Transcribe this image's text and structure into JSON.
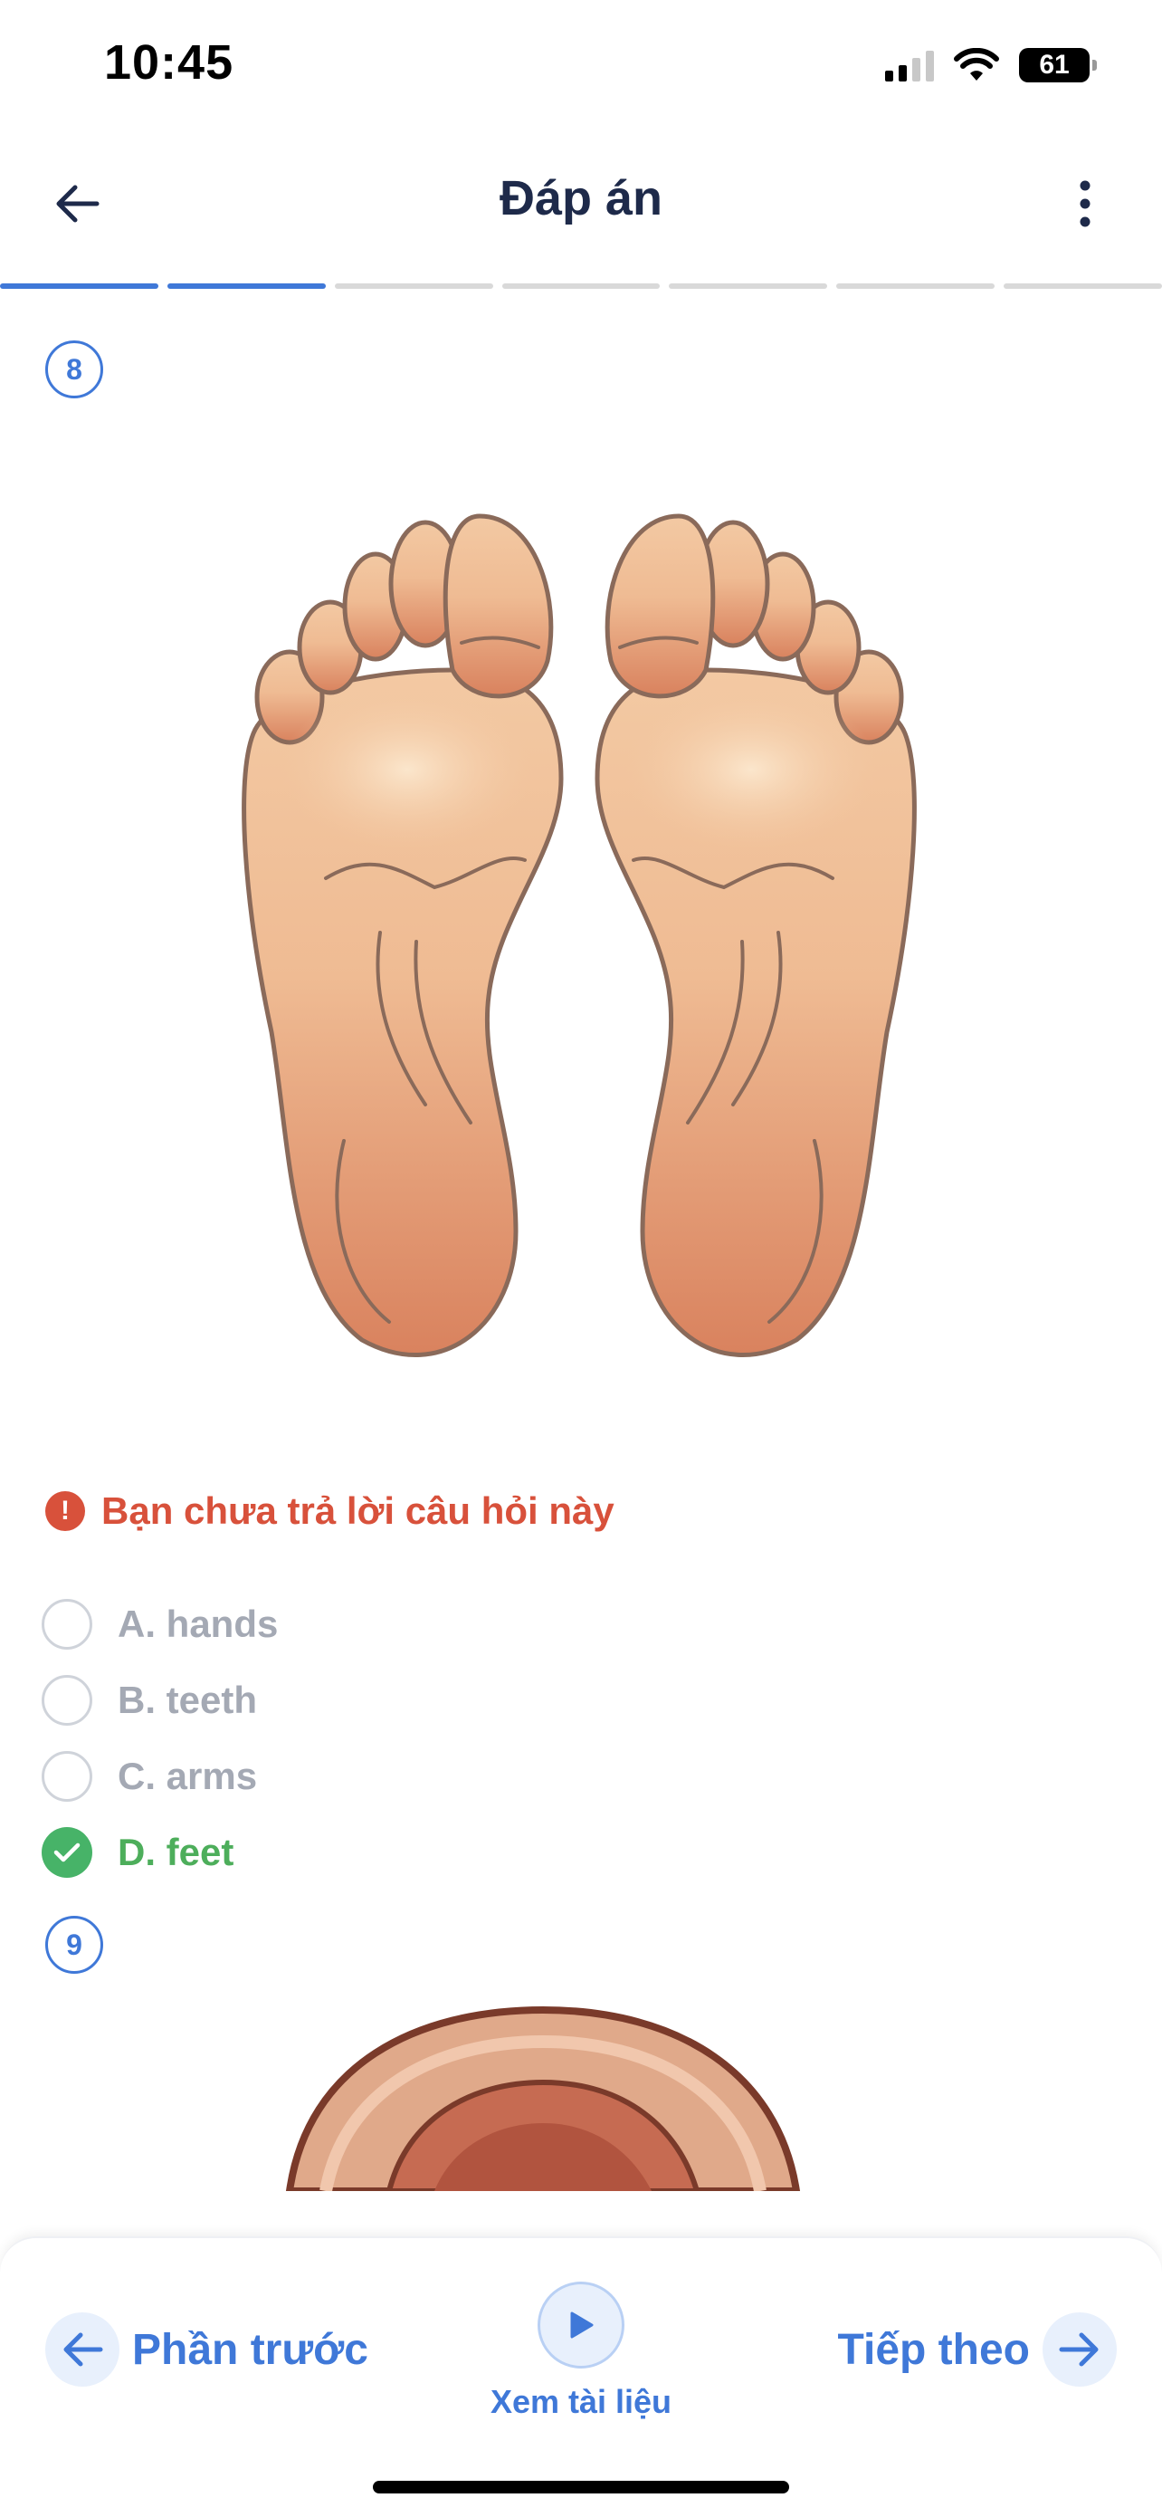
{
  "status": {
    "time": "10:45",
    "battery": "61"
  },
  "header": {
    "title": "Đáp án",
    "back_icon": "arrow-left-icon",
    "more_icon": "more-vertical-icon"
  },
  "progress": {
    "total": 7,
    "completed": 2
  },
  "questions": [
    {
      "number": "8",
      "image_icon": "feet-soles-illustration",
      "warning": "Bạn chưa trả lời câu hỏi này",
      "options": [
        {
          "label": "A. hands",
          "correct": false
        },
        {
          "label": "B. teeth",
          "correct": false
        },
        {
          "label": "C. arms",
          "correct": false
        },
        {
          "label": "D. feet",
          "correct": true
        }
      ]
    },
    {
      "number": "9",
      "image_icon": "ear-illustration"
    }
  ],
  "bottom_nav": {
    "prev_label": "Phần trước",
    "next_label": "Tiếp theo",
    "play_label": "Xem tài liệu"
  },
  "colors": {
    "accent": "#3f78d8",
    "warning": "#d8513b",
    "correct": "#47b368",
    "muted": "#a4a9b4"
  }
}
